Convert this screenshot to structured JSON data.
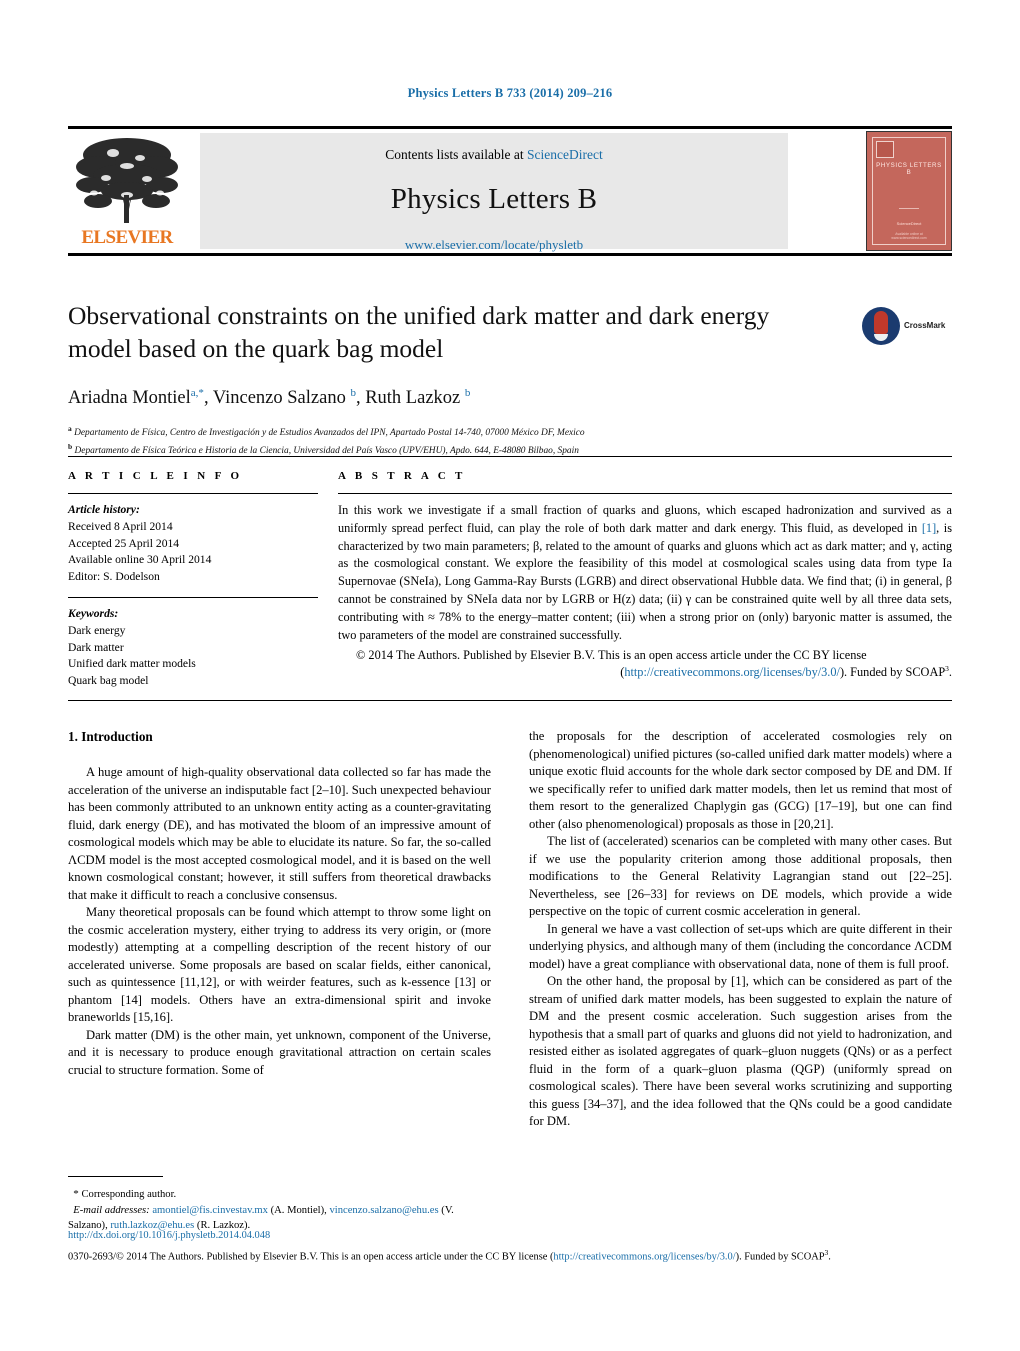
{
  "running_head": "Physics Letters B 733 (2014) 209–216",
  "masthead": {
    "contents_prefix": "Contents lists available at ",
    "sciencedirect": "ScienceDirect",
    "journal_name": "Physics Letters B",
    "journal_url": "www.elsevier.com/locate/physletb",
    "publisher_wordmark": "ELSEVIER",
    "cover_title": "PHYSICS LETTERS B",
    "cover_footer_note": "ScienceDirect",
    "cover_bottom_line": "Available online at www.sciencedirect.com"
  },
  "title": "Observational constraints on the unified dark matter and dark energy model based on the quark bag model",
  "crossmark_label": "CrossMark",
  "authors_html": "Ariadna Montiel<sup>a,*</sup>, Vincenzo Salzano <sup>b</sup>, Ruth Lazkoz <sup>b</sup>",
  "affiliations": [
    "Departamento de Física, Centro de Investigación y de Estudios Avanzados del IPN, Apartado Postal 14-740, 07000 México DF, Mexico",
    "Departamento de Física Teórica e Historia de la Ciencia, Universidad del País Vasco (UPV/EHU), Apdo. 644, E-48080 Bilbao, Spain"
  ],
  "article_info": {
    "heading": "A R T I C L E   I N F O",
    "history_label": "Article history:",
    "history": [
      "Received 8 April 2014",
      "Accepted 25 April 2014",
      "Available online 30 April 2014",
      "Editor: S. Dodelson"
    ],
    "keywords_label": "Keywords:",
    "keywords": [
      "Dark energy",
      "Dark matter",
      "Unified dark matter models",
      "Quark bag model"
    ]
  },
  "abstract": {
    "heading": "A B S T R A C T",
    "body_parts": [
      "In this work we investigate if a small fraction of quarks and gluons, which escaped hadronization and survived as a uniformly spread perfect fluid, can play the role of both dark matter and dark energy. This fluid, as developed in ",
      "[1]",
      ", is characterized by two main parameters; β, related to the amount of quarks and gluons which act as dark matter; and γ, acting as the cosmological constant. We explore the feasibility of this model at cosmological scales using data from type Ia Supernovae (SNeIa), Long Gamma-Ray Bursts (LGRB) and direct observational Hubble data. We find that; (i) in general, β cannot be constrained by SNeIa data nor by LGRB or H(z) data; (ii) γ can be constrained quite well by all three data sets, contributing with ≈ 78% to the energy–matter content; (iii) when a strong prior on (only) baryonic matter is assumed, the two parameters of the model are constrained successfully."
    ],
    "copyright_line1": "© 2014 The Authors. Published by Elsevier B.V. This is an open access article under the CC BY license",
    "copyright_link": "http://creativecommons.org/licenses/by/3.0/",
    "copyright_after": "). Funded by SCOAP",
    "copyright_sup": "3",
    "copyright_end": ".",
    "copyright_paren": "("
  },
  "left_column": {
    "section_heading": "1. Introduction",
    "paragraphs": [
      "A huge amount of high-quality observational data collected so far has made the acceleration of the universe an indisputable fact [2–10]. Such unexpected behaviour has been commonly attributed to an unknown entity acting as a counter-gravitating fluid, dark energy (DE), and has motivated the bloom of an impressive amount of cosmological models which may be able to elucidate its nature. So far, the so-called ΛCDM model is the most accepted cosmological model, and it is based on the well known cosmological constant; however, it still suffers from theoretical drawbacks that make it difficult to reach a conclusive consensus.",
      "Many theoretical proposals can be found which attempt to throw some light on the cosmic acceleration mystery, either trying to address its very origin, or (more modestly) attempting at a compelling description of the recent history of our accelerated universe. Some proposals are based on scalar fields, either canonical, such as quintessence [11,12], or with weirder features, such as k-essence [13] or phantom [14] models. Others have an extra-dimensional spirit and invoke braneworlds [15,16].",
      "Dark matter (DM) is the other main, yet unknown, component of the Universe, and it is necessary to produce enough gravitational attraction on certain scales crucial to structure formation. Some of"
    ]
  },
  "right_column": {
    "paragraphs": [
      "the proposals for the description of accelerated cosmologies rely on (phenomenological) unified pictures (so-called unified dark matter models) where a unique exotic fluid accounts for the whole dark sector composed by DE and DM. If we specifically refer to unified dark matter models, then let us remind that most of them resort to the generalized Chaplygin gas (GCG) [17–19], but one can find other (also phenomenological) proposals as those in [20,21].",
      "The list of (accelerated) scenarios can be completed with many other cases. But if we use the popularity criterion among those additional proposals, then modifications to the General Relativity Lagrangian stand out [22–25]. Nevertheless, see [26–33] for reviews on DE models, which provide a wide perspective on the topic of current cosmic acceleration in general.",
      "In general we have a vast collection of set-ups which are quite different in their underlying physics, and although many of them (including the concordance ΛCDM model) have a great compliance with observational data, none of them is full proof.",
      "On the other hand, the proposal by [1], which can be considered as part of the stream of unified dark matter models, has been suggested to explain the nature of DM and the present cosmic acceleration. Such suggestion arises from the hypothesis that a small part of quarks and gluons did not yield to hadronization, and resisted either as isolated aggregates of quark–gluon nuggets (QNs) or as a perfect fluid in the form of a quark–gluon plasma (QGP) (uniformly spread on cosmological scales). There have been several works scrutinizing and supporting this guess [34–37], and the idea followed that the QNs could be a good candidate for DM."
    ]
  },
  "footnote": {
    "corresponding_marker": "*",
    "corresponding_text": "Corresponding author.",
    "email_label": "E-mail addresses:",
    "emails": [
      {
        "address": "amontiel@fis.cinvestav.mx",
        "owner": "(A. Montiel),"
      },
      {
        "address": "vincenzo.salzano@ehu.es",
        "owner": "(V. Salzano),"
      },
      {
        "address": "ruth.lazkoz@ehu.es",
        "owner": "(R. Lazkoz)."
      }
    ]
  },
  "page_footer": {
    "doi": "http://dx.doi.org/10.1016/j.physletb.2014.04.048",
    "issn_prefix": "0370-2693/",
    "issn_rest": "© 2014 The Authors. Published by Elsevier B.V. This is an open access article under the CC BY license (",
    "issn_link": "http://creativecommons.org/licenses/by/3.0/",
    "issn_after": "). Funded by SCOAP",
    "issn_sup": "3",
    "issn_end": "."
  },
  "colors": {
    "link": "#1a6ea8",
    "elsevier_orange": "#e87722",
    "cover_red": "#c4675c",
    "banner_gray": "#e8e8e8"
  }
}
